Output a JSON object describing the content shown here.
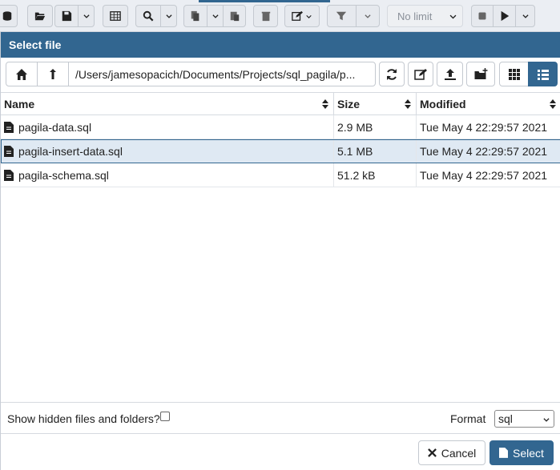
{
  "toolbar": {
    "limit_select": "No limit"
  },
  "dialog": {
    "title": "Select file",
    "path": "/Users/jamesopacich/Documents/Projects/sql_pagila/p..."
  },
  "table": {
    "headers": {
      "name": "Name",
      "size": "Size",
      "modified": "Modified"
    },
    "rows": [
      {
        "name": "pagila-data.sql",
        "size": "2.9 MB",
        "modified": "Tue May 4 22:29:57 2021"
      },
      {
        "name": "pagila-insert-data.sql",
        "size": "5.1 MB",
        "modified": "Tue May 4 22:29:57 2021",
        "selected": true
      },
      {
        "name": "pagila-schema.sql",
        "size": "51.2 kB",
        "modified": "Tue May 4 22:29:57 2021"
      }
    ]
  },
  "footer": {
    "show_hidden_label": "Show hidden files and folders?",
    "format_label": "Format",
    "format_value": "sql",
    "cancel_label": "Cancel",
    "select_label": "Select"
  },
  "colors": {
    "accent": "#326690",
    "selected_row": "#dfe9f3"
  }
}
